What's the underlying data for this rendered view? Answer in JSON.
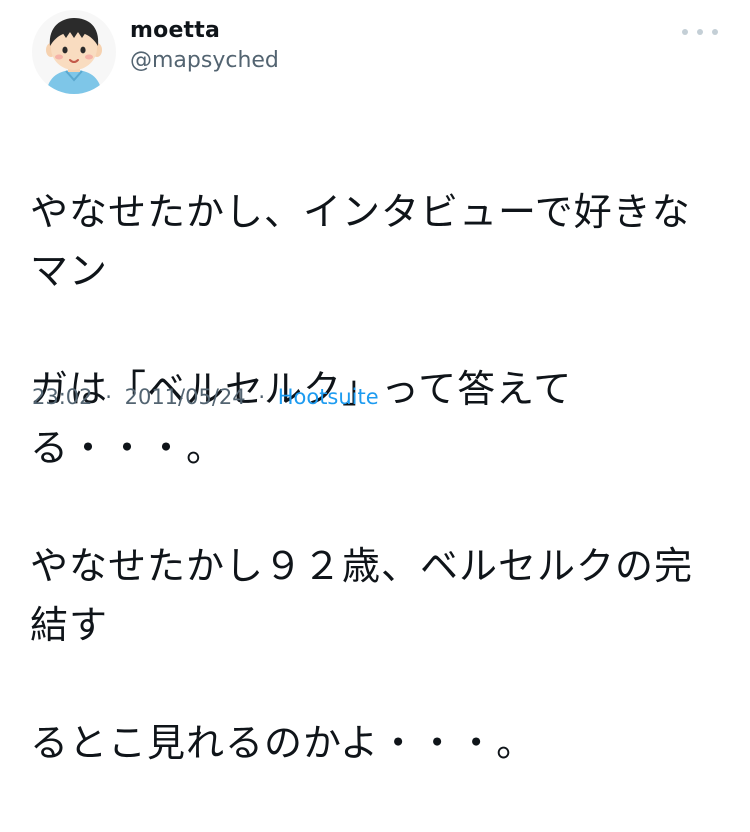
{
  "author": {
    "display_name": "moetta",
    "handle": "@mapsyched",
    "avatar_icon": "boy-avatar-icon"
  },
  "more_menu_icon": "ellipsis-icon",
  "tweet": {
    "text_lines": [
      "やなせたかし、インタビューで好きなマン",
      "ガは「ベルセルク」って答えてる・・・。",
      "やなせたかし９２歳、ベルセルクの完結す",
      "るとこ見れるのかよ・・・。"
    ]
  },
  "meta": {
    "time": "23:02",
    "date": "2011/05/24",
    "separator": "·",
    "source": "Hootsuite"
  },
  "colors": {
    "text": "#0f1419",
    "secondary": "#536471",
    "link": "#1d9bf0"
  }
}
